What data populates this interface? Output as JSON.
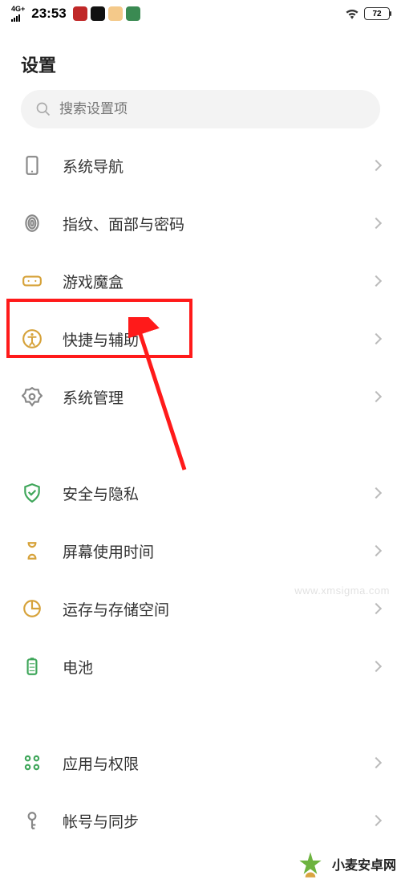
{
  "status": {
    "network": "4G+",
    "time": "23:53",
    "battery": "72",
    "app_icons": [
      {
        "bg": "#c02828"
      },
      {
        "bg": "#111"
      },
      {
        "bg": "#f4c98a"
      },
      {
        "bg": "#3a8a52"
      }
    ]
  },
  "page": {
    "title": "设置"
  },
  "search": {
    "placeholder": "搜索设置项"
  },
  "rows": [
    {
      "id": "system-nav",
      "label": "系统导航",
      "icon": "phone",
      "color": "#888"
    },
    {
      "id": "fingerprint",
      "label": "指纹、面部与密码",
      "icon": "fingerprint",
      "color": "#888"
    },
    {
      "id": "game-box",
      "label": "游戏魔盒",
      "icon": "gamepad",
      "color": "#d6a23a"
    },
    {
      "id": "accessibility",
      "label": "快捷与辅助",
      "icon": "accessibility",
      "color": "#d6a23a",
      "highlight": true
    },
    {
      "id": "system-mgmt",
      "label": "系统管理",
      "icon": "gear",
      "color": "#888"
    },
    {
      "id": "security",
      "label": "安全与隐私",
      "icon": "shield",
      "color": "#3fa65a",
      "sep": true
    },
    {
      "id": "screen-time",
      "label": "屏幕使用时间",
      "icon": "hourglass",
      "color": "#d6a23a"
    },
    {
      "id": "storage",
      "label": "运存与存储空间",
      "icon": "pie",
      "color": "#d6a23a"
    },
    {
      "id": "battery",
      "label": "电池",
      "icon": "battery",
      "color": "#3fa65a"
    },
    {
      "id": "apps",
      "label": "应用与权限",
      "icon": "grid",
      "color": "#3fa65a",
      "sep": true
    },
    {
      "id": "account",
      "label": "帐号与同步",
      "icon": "key",
      "color": "#888"
    }
  ],
  "watermarks": {
    "sigma": "www.xmsigma.com",
    "brand": "小麦安卓网"
  },
  "colors": {
    "accent_red": "#ff1a1a"
  }
}
